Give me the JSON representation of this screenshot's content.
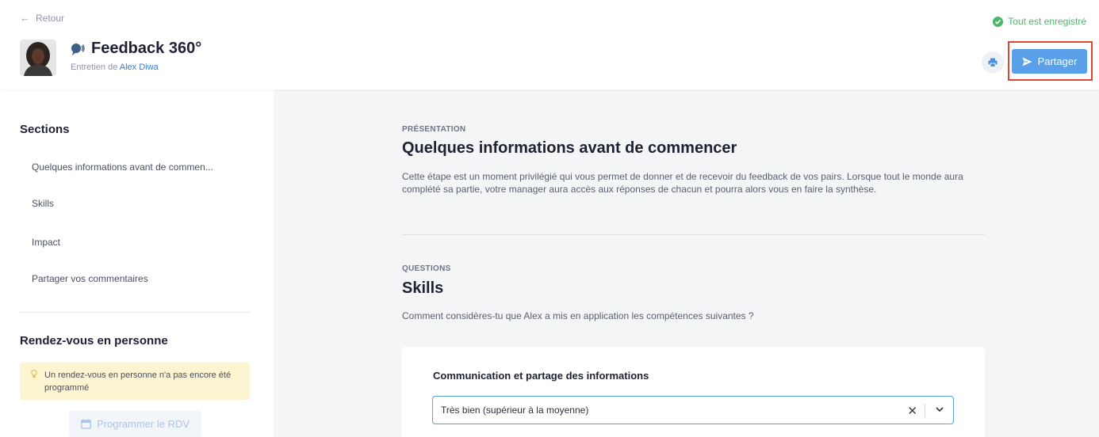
{
  "header": {
    "back_label": "Retour",
    "title_icon": "speech-bubble-icon",
    "title": "Feedback 360°",
    "subtitle_prefix": "Entretien de",
    "subtitle_link": "Alex Diwa",
    "save_status": "Tout est enregistré",
    "share_label": "Partager",
    "print_icon": "printer-icon"
  },
  "sidebar": {
    "sections_heading": "Sections",
    "items": [
      {
        "label": "Quelques informations avant de commen..."
      },
      {
        "label": "Skills"
      },
      {
        "label": "Impact"
      },
      {
        "label": "Partager vos commentaires"
      }
    ],
    "meeting_heading": "Rendez-vous en personne",
    "meeting_notice": "Un rendez-vous en personne n'a pas encore été programmé",
    "meeting_button": "Programmer le RDV"
  },
  "main": {
    "presentation": {
      "eyebrow": "PRÉSENTATION",
      "title": "Quelques informations avant de commencer",
      "text": "Cette étape est un moment privilégié qui vous permet de donner et de recevoir du feedback de vos pairs. Lorsque tout le monde aura complété sa partie, votre manager aura accès aux réponses de chacun et pourra alors vous en faire la synthèse."
    },
    "questions": {
      "eyebrow": "QUESTIONS",
      "title": "Skills",
      "text": "Comment considères-tu que Alex a mis en application les compétences suivantes ?"
    },
    "card": {
      "title": "Communication et partage des informations",
      "selected_value": "Très bien (supérieur à la moyenne)"
    }
  },
  "colors": {
    "accent": "#5aa0e8",
    "success": "#4fb56a",
    "highlight_frame": "#e0452f",
    "notice_bg": "#fdf4d1"
  }
}
